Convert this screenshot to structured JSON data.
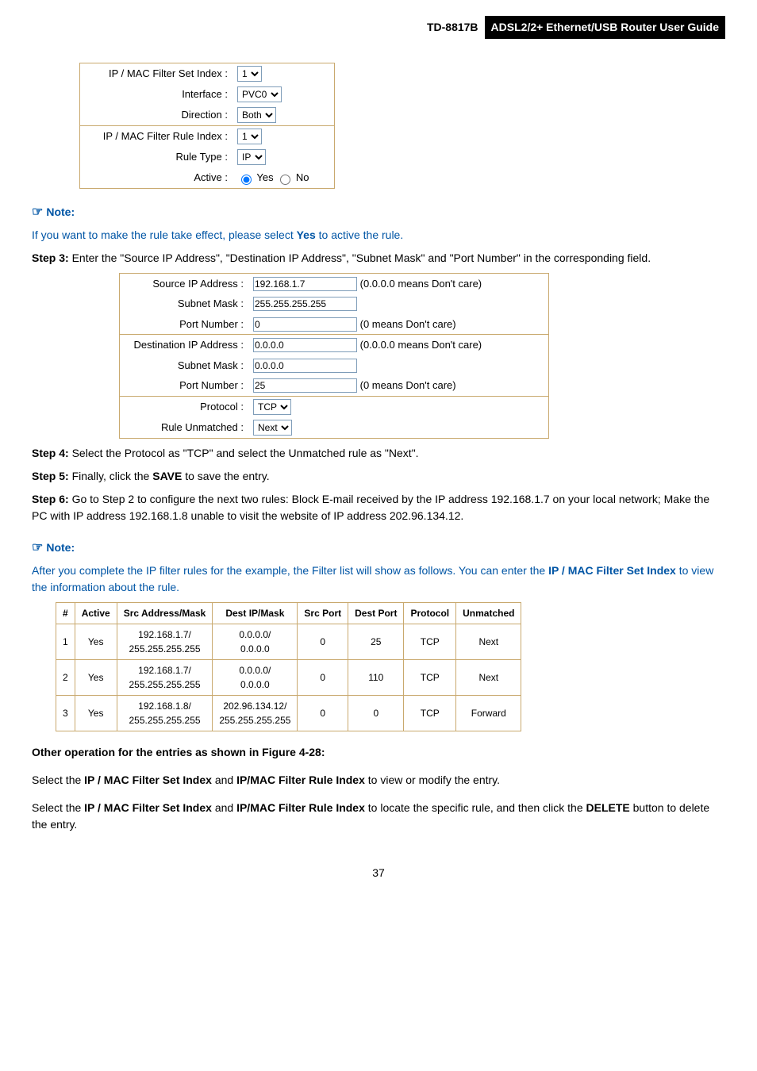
{
  "header": {
    "code": "TD-8817B",
    "title": "ADSL2/2+ Ethernet/USB Router User Guide"
  },
  "configBox1": {
    "rows1": [
      {
        "label": "IP / MAC Filter Set Index :",
        "value": "1",
        "name": "filter-set-index"
      },
      {
        "label": "Interface :",
        "value": "PVC0",
        "name": "interface-select"
      },
      {
        "label": "Direction :",
        "value": "Both",
        "name": "direction-select"
      }
    ],
    "rows2": [
      {
        "label": "IP / MAC Filter Rule Index :",
        "value": "1",
        "name": "filter-rule-index"
      },
      {
        "label": "Rule Type :",
        "value": "IP",
        "name": "rule-type-select"
      }
    ],
    "activeLabel": "Active :",
    "yes": "Yes",
    "no": "No"
  },
  "noteLabel": "Note:",
  "noteText1_a": "If you want to make the rule take effect, please select ",
  "noteText1_b": "Yes",
  "noteText1_c": " to active the rule.",
  "step3": {
    "label": "Step 3:",
    "text": "Enter the \"Source IP Address\", \"Destination IP Address\", \"Subnet Mask\" and \"Port Number\" in the corresponding field."
  },
  "configBox2": {
    "source": [
      {
        "label": "Source IP Address :",
        "value": "192.168.1.7",
        "hint": "(0.0.0.0 means Don't care)"
      },
      {
        "label": "Subnet Mask :",
        "value": "255.255.255.255",
        "hint": ""
      },
      {
        "label": "Port Number :",
        "value": "0",
        "hint": "(0 means Don't care)"
      }
    ],
    "dest": [
      {
        "label": "Destination IP Address :",
        "value": "0.0.0.0",
        "hint": "(0.0.0.0 means Don't care)"
      },
      {
        "label": "Subnet Mask :",
        "value": "0.0.0.0",
        "hint": ""
      },
      {
        "label": "Port Number :",
        "value": "25",
        "hint": "(0 means Don't care)"
      }
    ],
    "footer": [
      {
        "label": "Protocol :",
        "value": "TCP",
        "name": "protocol-select"
      },
      {
        "label": "Rule Unmatched :",
        "value": "Next",
        "name": "rule-unmatched-select"
      }
    ]
  },
  "step4": {
    "label": "Step 4:",
    "text": "Select the Protocol as \"TCP\" and select the Unmatched rule as \"Next\"."
  },
  "step5": {
    "label": "Step 5:",
    "text_a": "Finally, click the ",
    "bold": "SAVE",
    "text_b": " to save the entry."
  },
  "step6": {
    "label": "Step 6:",
    "text": "Go to Step 2 to configure the next two rules: Block E-mail received by the IP address 192.168.1.7 on your local network; Make the PC with IP address 192.168.1.8 unable to visit the website of IP address 202.96.134.12."
  },
  "noteText2_a": "After you complete the IP filter rules for the example, the Filter list will show as follows. You can enter the ",
  "noteText2_b": "IP / MAC Filter Set Index",
  "noteText2_c": " to view the information about the rule.",
  "resultTable": {
    "headers": [
      "#",
      "Active",
      "Src Address/Mask",
      "Dest IP/Mask",
      "Src Port",
      "Dest Port",
      "Protocol",
      "Unmatched"
    ],
    "rows": [
      {
        "n": "1",
        "active": "Yes",
        "src": "192.168.1.7/\n255.255.255.255",
        "dest": "0.0.0.0/\n0.0.0.0",
        "srcport": "0",
        "destport": "25",
        "proto": "TCP",
        "unm": "Next"
      },
      {
        "n": "2",
        "active": "Yes",
        "src": "192.168.1.7/\n255.255.255.255",
        "dest": "0.0.0.0/\n0.0.0.0",
        "srcport": "0",
        "destport": "110",
        "proto": "TCP",
        "unm": "Next"
      },
      {
        "n": "3",
        "active": "Yes",
        "src": "192.168.1.8/\n255.255.255.255",
        "dest": "202.96.134.12/\n255.255.255.255",
        "srcport": "0",
        "destport": "0",
        "proto": "TCP",
        "unm": "Forward"
      }
    ]
  },
  "otherOpHead": "Other operation for the entries as shown in Figure 4-28:",
  "otherOp1_a": "Select the ",
  "otherOp1_b": "IP / MAC Filter Set Index",
  "otherOp1_c": " and ",
  "otherOp1_d": "IP/MAC Filter Rule Index",
  "otherOp1_e": " to view or modify the entry.",
  "otherOp2_a": "Select the ",
  "otherOp2_b": "IP / MAC Filter Set Index",
  "otherOp2_c": " and ",
  "otherOp2_d": "IP/MAC Filter Rule Index",
  "otherOp2_e": " to locate the specific rule, and then click the ",
  "otherOp2_f": "DELETE",
  "otherOp2_g": " button to delete the entry.",
  "pageNum": "37"
}
